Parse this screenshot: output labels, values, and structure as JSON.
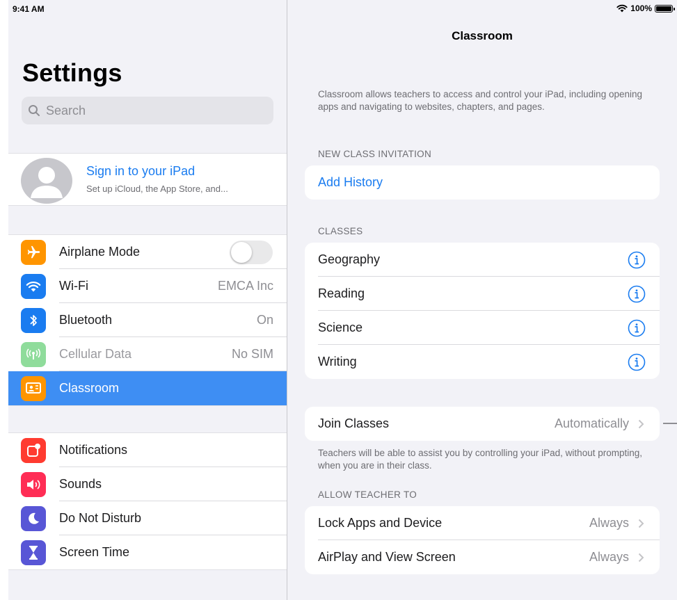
{
  "status_bar": {
    "time": "9:41 AM",
    "battery": "100%"
  },
  "sidebar": {
    "title": "Settings",
    "search_placeholder": "Search",
    "profile": {
      "name": "Sign in to your iPad",
      "subtitle": "Set up iCloud, the App Store, and..."
    },
    "group1": [
      {
        "label": "Airplane Mode",
        "icon": "airplane-icon",
        "color": "#ff9500",
        "toggle": false
      },
      {
        "label": "Wi-Fi",
        "value": "EMCA Inc",
        "icon": "wifi-icon",
        "color": "#1a7cf0"
      },
      {
        "label": "Bluetooth",
        "value": "On",
        "icon": "bluetooth-icon",
        "color": "#1a7cf0"
      },
      {
        "label": "Cellular Data",
        "value": "No SIM",
        "icon": "antenna-icon",
        "color": "#8fdc9b",
        "disabled": true
      },
      {
        "label": "Classroom",
        "icon": "classroom-icon",
        "color": "#ff9500",
        "selected": true
      }
    ],
    "group2": [
      {
        "label": "Notifications",
        "icon": "notifications-icon",
        "color": "#ff3b30"
      },
      {
        "label": "Sounds",
        "icon": "speaker-icon",
        "color": "#ff2d55"
      },
      {
        "label": "Do Not Disturb",
        "icon": "moon-icon",
        "color": "#5856d6"
      },
      {
        "label": "Screen Time",
        "icon": "hourglass-icon",
        "color": "#5856d6"
      }
    ]
  },
  "detail": {
    "title": "Classroom",
    "intro": "Classroom allows teachers to access and control your iPad, including opening apps and navigating to websites, chapters, and pages.",
    "invitation_header": "NEW CLASS INVITATION",
    "add_history": "Add History",
    "classes_header": "CLASSES",
    "classes": [
      "Geography",
      "Reading",
      "Science",
      "Writing"
    ],
    "join": {
      "label": "Join Classes",
      "value": "Automatically"
    },
    "join_note": "Teachers will be able to assist you by controlling your iPad, without prompting, when you are in their class.",
    "allow_header": "ALLOW TEACHER TO",
    "allow": [
      {
        "label": "Lock Apps and Device",
        "value": "Always"
      },
      {
        "label": "AirPlay and View Screen",
        "value": "Always"
      }
    ]
  }
}
